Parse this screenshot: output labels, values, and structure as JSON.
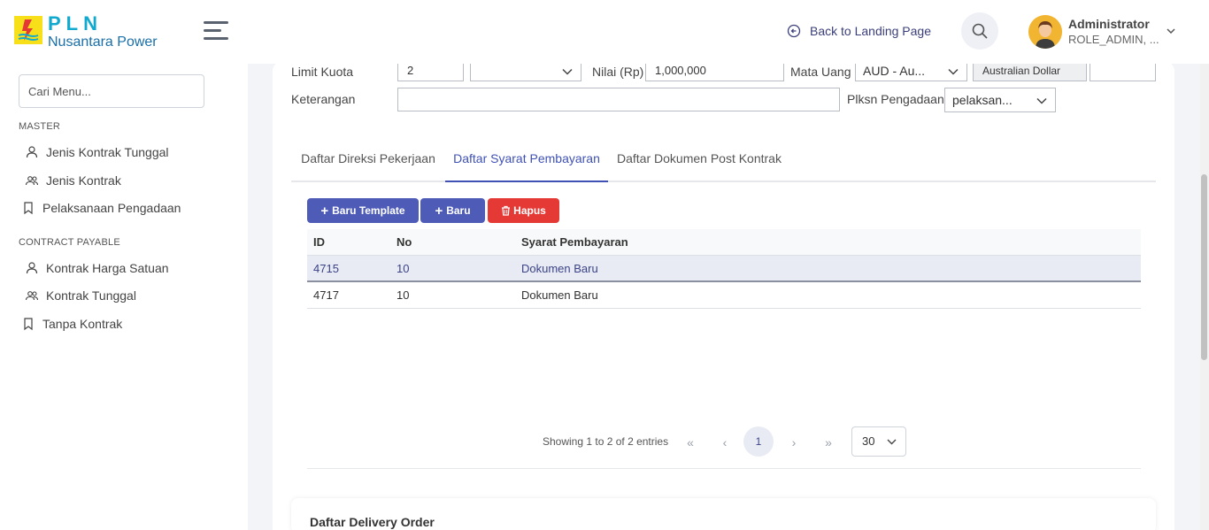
{
  "brand": {
    "name": "PLN",
    "subtitle": "Nusantara Power"
  },
  "header": {
    "back_link": "Back to Landing Page",
    "user_name": "Administrator",
    "user_role": "ROLE_ADMIN, ..."
  },
  "sidebar": {
    "search_placeholder": "Cari Menu...",
    "sections": [
      {
        "title": "MASTER",
        "items": [
          "Jenis Kontrak Tunggal",
          "Jenis Kontrak",
          "Pelaksanaan Pengadaan"
        ]
      },
      {
        "title": "CONTRACT PAYABLE",
        "items": [
          "Kontrak Harga Satuan",
          "Kontrak Tunggal",
          "Tanpa Kontrak"
        ]
      }
    ]
  },
  "form": {
    "limit_kuota_label": "Limit Kuota",
    "limit_kuota_value": "2",
    "limit_kuota_unit_value": "",
    "nilai_label": "Nilai (Rp)",
    "nilai_value": "1,000,000",
    "mata_uang_label": "Mata Uang",
    "mata_uang_value": "AUD - Au...",
    "currency_name": "Australian Dollar",
    "currency_extra": "",
    "keterangan_label": "Keterangan",
    "keterangan_value": "",
    "plksn_label": "Plksn Pengadaan",
    "plksn_value": "pelaksan..."
  },
  "tabs": [
    {
      "label": "Daftar Direksi Pekerjaan",
      "active": false
    },
    {
      "label": "Daftar Syarat Pembayaran",
      "active": true
    },
    {
      "label": "Daftar Dokumen Post Kontrak",
      "active": false
    }
  ],
  "actions": {
    "baru_template": "Baru Template",
    "baru": "Baru",
    "hapus": "Hapus"
  },
  "table": {
    "columns": [
      "ID",
      "No",
      "Syarat Pembayaran"
    ],
    "rows": [
      {
        "id": "4715",
        "no": "10",
        "syarat": "Dokumen Baru",
        "selected": true
      },
      {
        "id": "4717",
        "no": "10",
        "syarat": "Dokumen Baru",
        "selected": false
      }
    ]
  },
  "pagination": {
    "info": "Showing 1 to 2 of 2 entries",
    "current_page": "1",
    "page_size": "30"
  },
  "section2_title": "Daftar Delivery Order",
  "colors": {
    "primary": "#4e5cb8",
    "danger": "#e53935",
    "brand_yellow": "#f7e01a",
    "brand_blue": "#12a9cf"
  }
}
